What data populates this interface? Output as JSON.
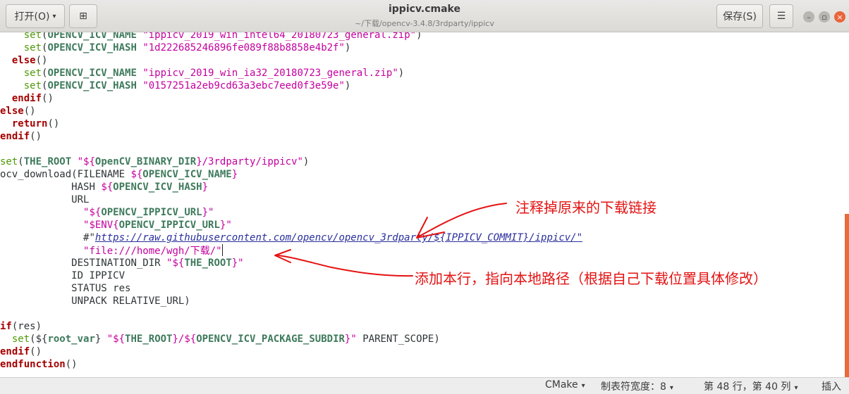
{
  "header": {
    "open_label": "打开(O)",
    "open_caret": "▾",
    "new_tab_icon": "⊞",
    "title": "ippicv.cmake",
    "subtitle": "~/下载/opencv-3.4.8/3rdparty/ippicv",
    "save_label": "保存(S)",
    "menu_icon": "☰",
    "min_glyph": "–",
    "max_glyph": "▫",
    "close_glyph": "×"
  },
  "code": {
    "lines": [
      [
        [
          "    ",
          ""
        ],
        [
          "set",
          "fn"
        ],
        [
          "(",
          ""
        ],
        [
          "OPENCV_ICV_NAME",
          "var"
        ],
        [
          " ",
          ""
        ],
        [
          "\"ippicv_2019_win_intel64_20180723_general.zip\"",
          "str"
        ],
        [
          ")",
          ""
        ]
      ],
      [
        [
          "    ",
          ""
        ],
        [
          "set",
          "fn"
        ],
        [
          "(",
          ""
        ],
        [
          "OPENCV_ICV_HASH",
          "var"
        ],
        [
          " ",
          ""
        ],
        [
          "\"1d222685246896fe089f88b8858e4b2f\"",
          "str"
        ],
        [
          ")",
          ""
        ]
      ],
      [
        [
          "  ",
          ""
        ],
        [
          "else",
          "kw"
        ],
        [
          "()",
          ""
        ]
      ],
      [
        [
          "    ",
          ""
        ],
        [
          "set",
          "fn"
        ],
        [
          "(",
          ""
        ],
        [
          "OPENCV_ICV_NAME",
          "var"
        ],
        [
          " ",
          ""
        ],
        [
          "\"ippicv_2019_win_ia32_20180723_general.zip\"",
          "str"
        ],
        [
          ")",
          ""
        ]
      ],
      [
        [
          "    ",
          ""
        ],
        [
          "set",
          "fn"
        ],
        [
          "(",
          ""
        ],
        [
          "OPENCV_ICV_HASH",
          "var"
        ],
        [
          " ",
          ""
        ],
        [
          "\"0157251a2eb9cd63a3ebc7eed0f3e59e\"",
          "str"
        ],
        [
          ")",
          ""
        ]
      ],
      [
        [
          "  ",
          ""
        ],
        [
          "endif",
          "kw"
        ],
        [
          "()",
          ""
        ]
      ],
      [
        [
          "",
          ""
        ],
        [
          "else",
          "kw"
        ],
        [
          "()",
          ""
        ]
      ],
      [
        [
          "  ",
          ""
        ],
        [
          "return",
          "kw"
        ],
        [
          "()",
          ""
        ]
      ],
      [
        [
          "",
          ""
        ],
        [
          "endif",
          "kw"
        ],
        [
          "()",
          ""
        ]
      ],
      [],
      [
        [
          "",
          ""
        ],
        [
          "set",
          "fn"
        ],
        [
          "(",
          ""
        ],
        [
          "THE_ROOT",
          "var"
        ],
        [
          " ",
          ""
        ],
        [
          "\"${",
          "str"
        ],
        [
          "OpenCV_BINARY_DIR",
          "var"
        ],
        [
          "}/3rdparty/ippicv\"",
          "str"
        ],
        [
          ")",
          ""
        ]
      ],
      [
        [
          "",
          ""
        ],
        [
          "ocv_download(FILENAME ",
          ""
        ],
        [
          "${",
          "str"
        ],
        [
          "OPENCV_ICV_NAME",
          "var"
        ],
        [
          "}",
          "str"
        ]
      ],
      [
        [
          "            ",
          ""
        ],
        [
          "HASH ",
          ""
        ],
        [
          "${",
          "str"
        ],
        [
          "OPENCV_ICV_HASH",
          "var"
        ],
        [
          "}",
          "str"
        ]
      ],
      [
        [
          "            ",
          ""
        ],
        [
          "URL",
          ""
        ]
      ],
      [
        [
          "              ",
          ""
        ],
        [
          "\"${",
          "str"
        ],
        [
          "OPENCV_IPPICV_URL",
          "var"
        ],
        [
          "}\"",
          "str"
        ]
      ],
      [
        [
          "              ",
          ""
        ],
        [
          "\"$ENV{",
          "str"
        ],
        [
          "OPENCV_IPPICV_URL",
          "var"
        ],
        [
          "}\"",
          "str"
        ]
      ],
      [
        [
          "              ",
          ""
        ],
        [
          "#\"",
          ""
        ],
        [
          "https://raw.githubusercontent.com/opencv/opencv_3rdparty/${IPPICV_COMMIT}/ippicv/\"",
          "ul"
        ]
      ],
      [
        [
          "              ",
          ""
        ],
        [
          "\"file:///home/wgh/下载/\"",
          "str"
        ],
        [
          "|",
          "cursor"
        ]
      ],
      [
        [
          "            ",
          ""
        ],
        [
          "DESTINATION_DIR ",
          ""
        ],
        [
          "\"${",
          "str"
        ],
        [
          "THE_ROOT",
          "var"
        ],
        [
          "}\"",
          "str"
        ]
      ],
      [
        [
          "            ",
          ""
        ],
        [
          "ID IPPICV",
          ""
        ]
      ],
      [
        [
          "            ",
          ""
        ],
        [
          "STATUS res",
          ""
        ]
      ],
      [
        [
          "            ",
          ""
        ],
        [
          "UNPACK RELATIVE_URL)",
          ""
        ]
      ],
      [],
      [
        [
          "",
          ""
        ],
        [
          "if",
          "kw"
        ],
        [
          "(res)",
          ""
        ]
      ],
      [
        [
          "  ",
          ""
        ],
        [
          "set",
          "fn"
        ],
        [
          "(${",
          ""
        ],
        [
          "root_var",
          "var"
        ],
        [
          "} ",
          ""
        ],
        [
          "\"${",
          "str"
        ],
        [
          "THE_ROOT",
          "var"
        ],
        [
          "}/${",
          "str"
        ],
        [
          "OPENCV_ICV_PACKAGE_SUBDIR",
          "var"
        ],
        [
          "}\"",
          "str"
        ],
        [
          " PARENT_SCOPE)",
          ""
        ]
      ],
      [
        [
          "",
          ""
        ],
        [
          "endif",
          "kw"
        ],
        [
          "()",
          ""
        ]
      ],
      [
        [
          "endfunction",
          "kw"
        ],
        [
          "()",
          ""
        ]
      ]
    ]
  },
  "annotations": {
    "note1": "注释掉原来的下载链接",
    "note2": "添加本行，指向本地路径（根据自己下载位置具体修改）"
  },
  "status": {
    "language": "CMake",
    "tab_width": "制表符宽度：8",
    "position": "第 48 行，第 40 列",
    "mode": "插入",
    "dropdown_glyph": "▾"
  },
  "colors": {
    "annotation_red": "#e41212",
    "keyword": "#a40000",
    "string": "#c4009e",
    "variable": "#3e7a5c",
    "function": "#4e9a06",
    "close_button": "#e9643a"
  }
}
